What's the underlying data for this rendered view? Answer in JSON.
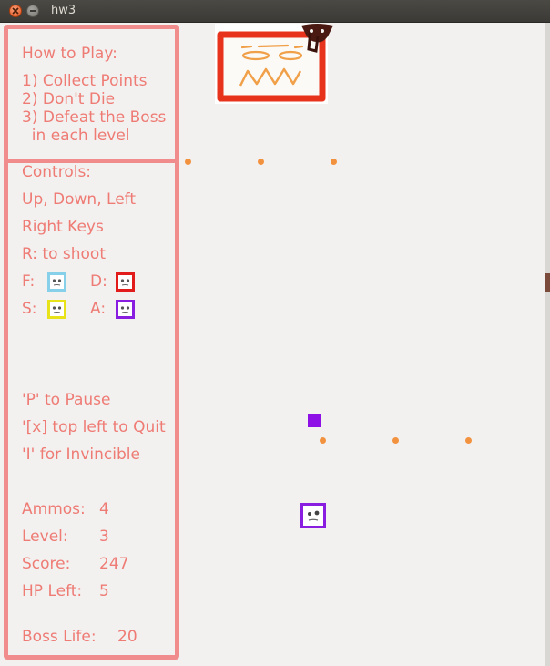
{
  "window": {
    "title": "hw3"
  },
  "how_to_play": {
    "heading": "How to Play:",
    "lines": [
      "1) Collect Points",
      "2) Don't Die",
      "3) Defeat the Boss",
      "  in each level"
    ]
  },
  "controls": {
    "heading": "Controls:",
    "lines": [
      "Up, Down, Left",
      "Right Keys",
      "R: to shoot"
    ],
    "keys": [
      {
        "key": "F:",
        "color": "#86d0ea",
        "icon": "face-icon"
      },
      {
        "key": "D:",
        "color": "#e21b1b",
        "icon": "face-icon"
      },
      {
        "key": "S:",
        "color": "#e8e21a",
        "icon": "face-icon"
      },
      {
        "key": "A:",
        "color": "#8a1ee0",
        "icon": "face-icon"
      }
    ],
    "extra": [
      "'P' to Pause",
      "'[x] top left to Quit",
      "'I' for Invincible"
    ]
  },
  "stats": {
    "ammos_label": "Ammos:",
    "ammos_value": "4",
    "level_label": "Level:",
    "level_value": "3",
    "score_label": "Score:",
    "score_value": "247",
    "hp_label": "HP Left:",
    "hp_value": "5",
    "boss_label": "Boss Life:",
    "boss_value": "20"
  },
  "colors": {
    "panel_border": "#f08c8c",
    "panel_text": "#ef7b75",
    "point_dot": "#f3923e",
    "player": "#8e10e6",
    "boss_frame": "#e8331c"
  },
  "icons": {
    "close": "close-icon",
    "minimize": "minimize-icon",
    "boss": "boss-sprite",
    "enemy": "enemy-face-icon",
    "point": "point-dot"
  }
}
